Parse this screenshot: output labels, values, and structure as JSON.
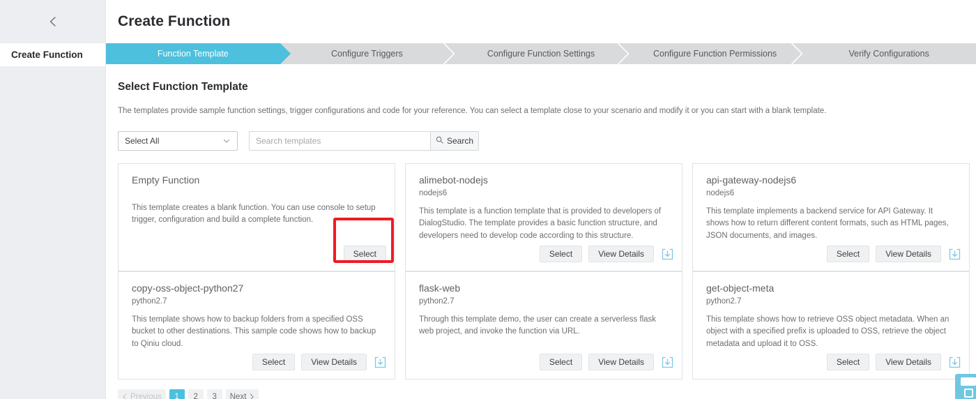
{
  "sidebar": {
    "back_icon": "chevron-left-icon",
    "items": [
      {
        "label": "Create Function"
      }
    ]
  },
  "header": {
    "title": "Create Function"
  },
  "steps": [
    {
      "label": "Function Template",
      "active": true
    },
    {
      "label": "Configure Triggers",
      "active": false
    },
    {
      "label": "Configure Function Settings",
      "active": false
    },
    {
      "label": "Configure Function Permissions",
      "active": false
    },
    {
      "label": "Verify Configurations",
      "active": false
    }
  ],
  "section": {
    "title": "Select Function Template",
    "description": "The templates provide sample function settings, trigger configurations and code for your reference. You can select a template close to your scenario and modify it or you can start with a blank template."
  },
  "filter": {
    "select_value": "Select All",
    "select_icon": "chevron-down-icon",
    "search_placeholder": "Search templates",
    "search_value": "",
    "search_button_label": "Search",
    "search_icon": "search-icon"
  },
  "buttons": {
    "select": "Select",
    "view_details": "View Details",
    "download_icon": "download-icon"
  },
  "cards": [
    {
      "title": "Empty Function",
      "runtime": "",
      "description": "This template creates a blank function. You can use console to setup trigger, configuration and build a complete function.",
      "has_view_details": false,
      "has_download": false
    },
    {
      "title": "alimebot-nodejs",
      "runtime": "nodejs6",
      "description": "This template is a function template that is provided to developers of DialogStudio. The template provides a basic function structure, and developers need to develop code according to this structure.",
      "has_view_details": true,
      "has_download": true
    },
    {
      "title": "api-gateway-nodejs6",
      "runtime": "nodejs6",
      "description": "This template implements a backend service for API Gateway. It shows how to return different content formats, such as HTML pages, JSON documents, and images.",
      "has_view_details": true,
      "has_download": true
    },
    {
      "title": "copy-oss-object-python27",
      "runtime": "python2.7",
      "description": "This template shows how to backup folders from a specified OSS bucket to other destinations. This sample code shows how to backup to Qiniu cloud.",
      "has_view_details": true,
      "has_download": true
    },
    {
      "title": "flask-web",
      "runtime": "python2.7",
      "description": "Through this template demo, the user can create a serverless flask web project, and invoke the function via URL.",
      "has_view_details": true,
      "has_download": true
    },
    {
      "title": "get-object-meta",
      "runtime": "python2.7",
      "description": "This template shows how to retrieve OSS object metadata. When an object with a specified prefix is uploaded to OSS, retrieve the object metadata and upload it to OSS.",
      "has_view_details": true,
      "has_download": true
    }
  ],
  "pagination": {
    "previous_label": "Previous",
    "next_label": "Next",
    "pages": [
      "1",
      "2",
      "3"
    ],
    "current_page": "1"
  },
  "colors": {
    "accent": "#4cc0dd",
    "step_inactive": "#d9dadb",
    "highlight": "#ee1c25",
    "download_icon": "#7ac9e3"
  },
  "annotation": {
    "highlight_target": "select-button-card-0"
  }
}
